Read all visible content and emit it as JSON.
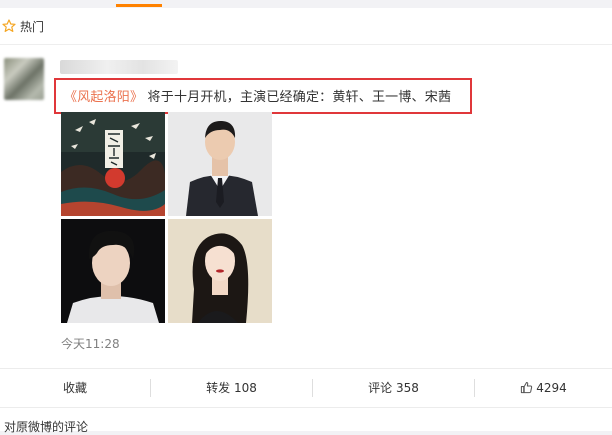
{
  "section": {
    "title": "热门",
    "icon": "star-outline-icon"
  },
  "post": {
    "link_text": "《风起洛阳》",
    "body_text": "将于十月开机，主演已经确定：黄轩、王一博、宋茜",
    "timestamp": "今天11:28",
    "photos": [
      "poster-photo",
      "actor-photo-1",
      "actor-photo-2",
      "actress-photo"
    ]
  },
  "actions": {
    "collect": "收藏",
    "repost": "转发 108",
    "comment": "评论 358",
    "like_count": "4294"
  },
  "comments": {
    "title": "对原微博的评论"
  },
  "colors": {
    "accent": "#ff8200",
    "link": "#eb7350",
    "highlight": "#e0373a"
  }
}
